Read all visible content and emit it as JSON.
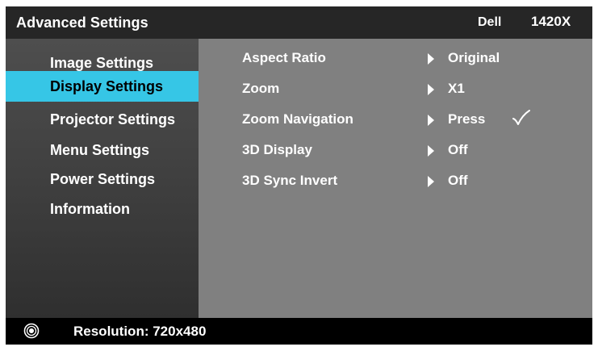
{
  "header": {
    "title": "Advanced Settings",
    "brand": "Dell",
    "model": "1420X"
  },
  "sidebar": {
    "items": [
      {
        "label": "Image Settings",
        "active": false
      },
      {
        "label": "Display Settings",
        "active": true
      },
      {
        "label": "Projector Settings",
        "active": false
      },
      {
        "label": "Menu Settings",
        "active": false
      },
      {
        "label": "Power Settings",
        "active": false
      },
      {
        "label": "Information",
        "active": false
      }
    ]
  },
  "settings": {
    "rows": [
      {
        "label": "Aspect Ratio",
        "value": "Original",
        "checked": false
      },
      {
        "label": "Zoom",
        "value": "X1",
        "checked": false
      },
      {
        "label": "Zoom Navigation",
        "value": "Press",
        "checked": true
      },
      {
        "label": "3D Display",
        "value": "Off",
        "checked": false
      },
      {
        "label": "3D Sync Invert",
        "value": "Off",
        "checked": false
      }
    ]
  },
  "footer": {
    "resolution_label": "Resolution: 720x480"
  },
  "colors": {
    "highlight": "#36c6e6",
    "panel_background": "#808080",
    "header_background": "#262626",
    "footer_background": "#000000",
    "text": "#ffffff"
  },
  "icons": {
    "resolution": "resolution-target-icon",
    "row_arrow": "triangle-right-icon",
    "selected_mark": "checkmark-icon"
  }
}
